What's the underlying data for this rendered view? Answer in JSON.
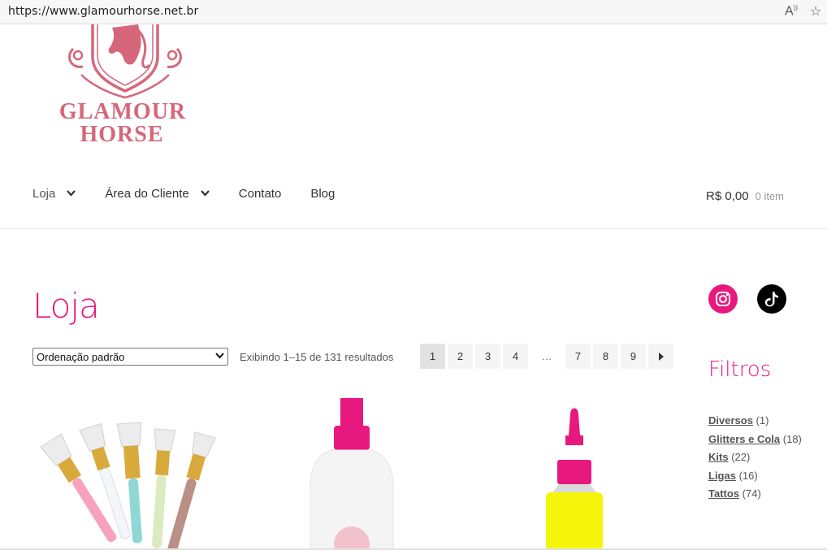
{
  "browser": {
    "url": "https://www.glamourhorse.net.br",
    "read_aloud_icon": "read-aloud-icon",
    "favorite_icon": "star-icon"
  },
  "logo": {
    "line1": "GLAMOUR",
    "line2": "HORSE",
    "color": "#d6677b"
  },
  "nav": {
    "items": [
      {
        "label": "Loja",
        "dropdown": true
      },
      {
        "label": "Área do Cliente",
        "dropdown": true
      },
      {
        "label": "Contato",
        "dropdown": false
      },
      {
        "label": "Blog",
        "dropdown": false
      }
    ]
  },
  "cart": {
    "amount": "R$ 0,00",
    "count": "0 item"
  },
  "page": {
    "title": "Loja",
    "accent": "#e8197e"
  },
  "sort": {
    "selected": "Ordenação padrão"
  },
  "results": {
    "text": "Exibindo 1–15 de 131 resultados"
  },
  "pagination": {
    "pages": [
      "1",
      "2",
      "3",
      "4",
      "…",
      "7",
      "8",
      "9"
    ],
    "current": "1"
  },
  "sidebar": {
    "social": [
      "instagram-icon",
      "tiktok-icon"
    ],
    "filters_title": "Filtros",
    "filters": [
      {
        "name": "Diversos",
        "count": "(1)"
      },
      {
        "name": "Glitters e Cola",
        "count": "(18)"
      },
      {
        "name": "Kits",
        "count": "(22)"
      },
      {
        "name": "Ligas",
        "count": "(16)"
      },
      {
        "name": "Tattos",
        "count": "(74)"
      }
    ]
  }
}
